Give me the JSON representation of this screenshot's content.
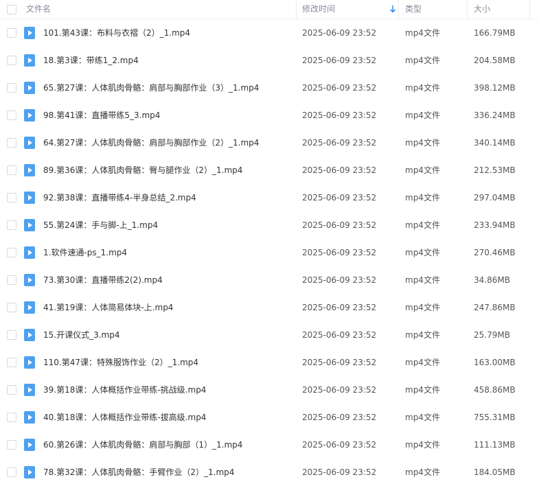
{
  "header": {
    "name_label": "文件名",
    "date_label": "修改时间",
    "type_label": "类型",
    "size_label": "大小",
    "sort_icon": "arrow-down-icon"
  },
  "colors": {
    "file_icon": "#4fa1f0",
    "header_text": "#878c9c"
  },
  "files": [
    {
      "name": "101.第43课：布料与衣褶（2）_1.mp4",
      "date": "2025-06-09 23:52",
      "type": "mp4文件",
      "size": "166.79MB"
    },
    {
      "name": "18.第3课：带练1_2.mp4",
      "date": "2025-06-09 23:52",
      "type": "mp4文件",
      "size": "204.58MB"
    },
    {
      "name": "65.第27课：人体肌肉骨骼：肩部与胸部作业（3）_1.mp4",
      "date": "2025-06-09 23:52",
      "type": "mp4文件",
      "size": "398.12MB"
    },
    {
      "name": "98.第41课：直播带练5_3.mp4",
      "date": "2025-06-09 23:52",
      "type": "mp4文件",
      "size": "336.24MB"
    },
    {
      "name": "64.第27课：人体肌肉骨骼：肩部与胸部作业（2）_1.mp4",
      "date": "2025-06-09 23:52",
      "type": "mp4文件",
      "size": "340.14MB"
    },
    {
      "name": "89.第36课：人体肌肉骨骼：臀与腿作业（2）_1.mp4",
      "date": "2025-06-09 23:52",
      "type": "mp4文件",
      "size": "212.53MB"
    },
    {
      "name": "92.第38课：直播带练4-半身总结_2.mp4",
      "date": "2025-06-09 23:52",
      "type": "mp4文件",
      "size": "297.04MB"
    },
    {
      "name": "55.第24课：手与脚-上_1.mp4",
      "date": "2025-06-09 23:52",
      "type": "mp4文件",
      "size": "233.94MB"
    },
    {
      "name": "1.软件速通-ps_1.mp4",
      "date": "2025-06-09 23:52",
      "type": "mp4文件",
      "size": "270.46MB"
    },
    {
      "name": "73.第30课：直播带练2(2).mp4",
      "date": "2025-06-09 23:52",
      "type": "mp4文件",
      "size": "34.86MB"
    },
    {
      "name": "41.第19课：人体简易体块-上.mp4",
      "date": "2025-06-09 23:52",
      "type": "mp4文件",
      "size": "247.86MB"
    },
    {
      "name": "15.开课仪式_3.mp4",
      "date": "2025-06-09 23:52",
      "type": "mp4文件",
      "size": "25.79MB"
    },
    {
      "name": "110.第47课：特殊服饰作业（2）_1.mp4",
      "date": "2025-06-09 23:52",
      "type": "mp4文件",
      "size": "163.00MB"
    },
    {
      "name": "39.第18课：人体概括作业带练-挑战级.mp4",
      "date": "2025-06-09 23:52",
      "type": "mp4文件",
      "size": "458.86MB"
    },
    {
      "name": "40.第18课：人体概括作业带练-拔高级.mp4",
      "date": "2025-06-09 23:52",
      "type": "mp4文件",
      "size": "755.31MB"
    },
    {
      "name": "60.第26课：人体肌肉骨骼：肩部与胸部（1）_1.mp4",
      "date": "2025-06-09 23:52",
      "type": "mp4文件",
      "size": "111.13MB"
    },
    {
      "name": "78.第32课：人体肌肉骨骼：手臂作业（2）_1.mp4",
      "date": "2025-06-09 23:52",
      "type": "mp4文件",
      "size": "184.05MB"
    }
  ]
}
